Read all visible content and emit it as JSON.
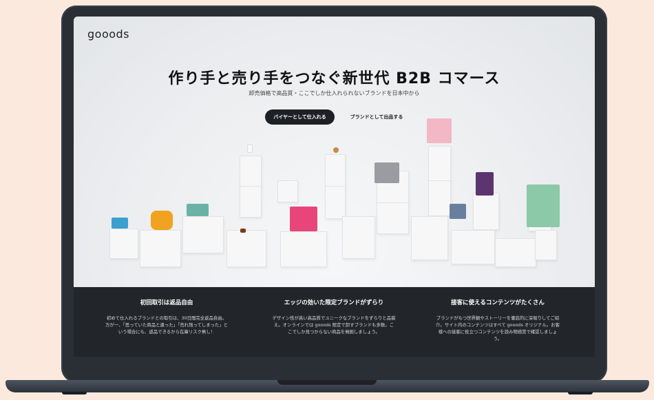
{
  "logo": "gooods",
  "hero": {
    "headline": "作り手と売り手をつなぐ新世代 B2B コマース",
    "subline": "卸売価格で高品質・ここでしか仕入れられないブランドを日本中から",
    "primary_button": "バイヤーとして仕入れる",
    "secondary_button": "ブランドとして出品する"
  },
  "features": [
    {
      "title": "初回取引は返品自由",
      "body": "初めて仕入れるブランドとの取引は、30日間完全返品自由。万が一、「思っていた商品と違った」「売れ残ってしまった」という場合にも、返品できるから在庫リスク無し！"
    },
    {
      "title": "エッジの効いた限定ブランドがずらり",
      "body": "デザイン性が高い高品質でユニークなブランドをずらりと品揃え。オンラインでは gooods 限定で卸すブランドも多数。ここでしか見つからない商品を発掘しましょう。"
    },
    {
      "title": "接客に使えるコンテンツがたくさん",
      "body": "ブランドがもつ世界観やストーリーを徹底的に深堀りしてご紹介。サイト内のコンテンツはすべて gooods オリジナル。お客様への接客に役立つコンテンツを読み物感覚で確認しましょう。"
    }
  ]
}
